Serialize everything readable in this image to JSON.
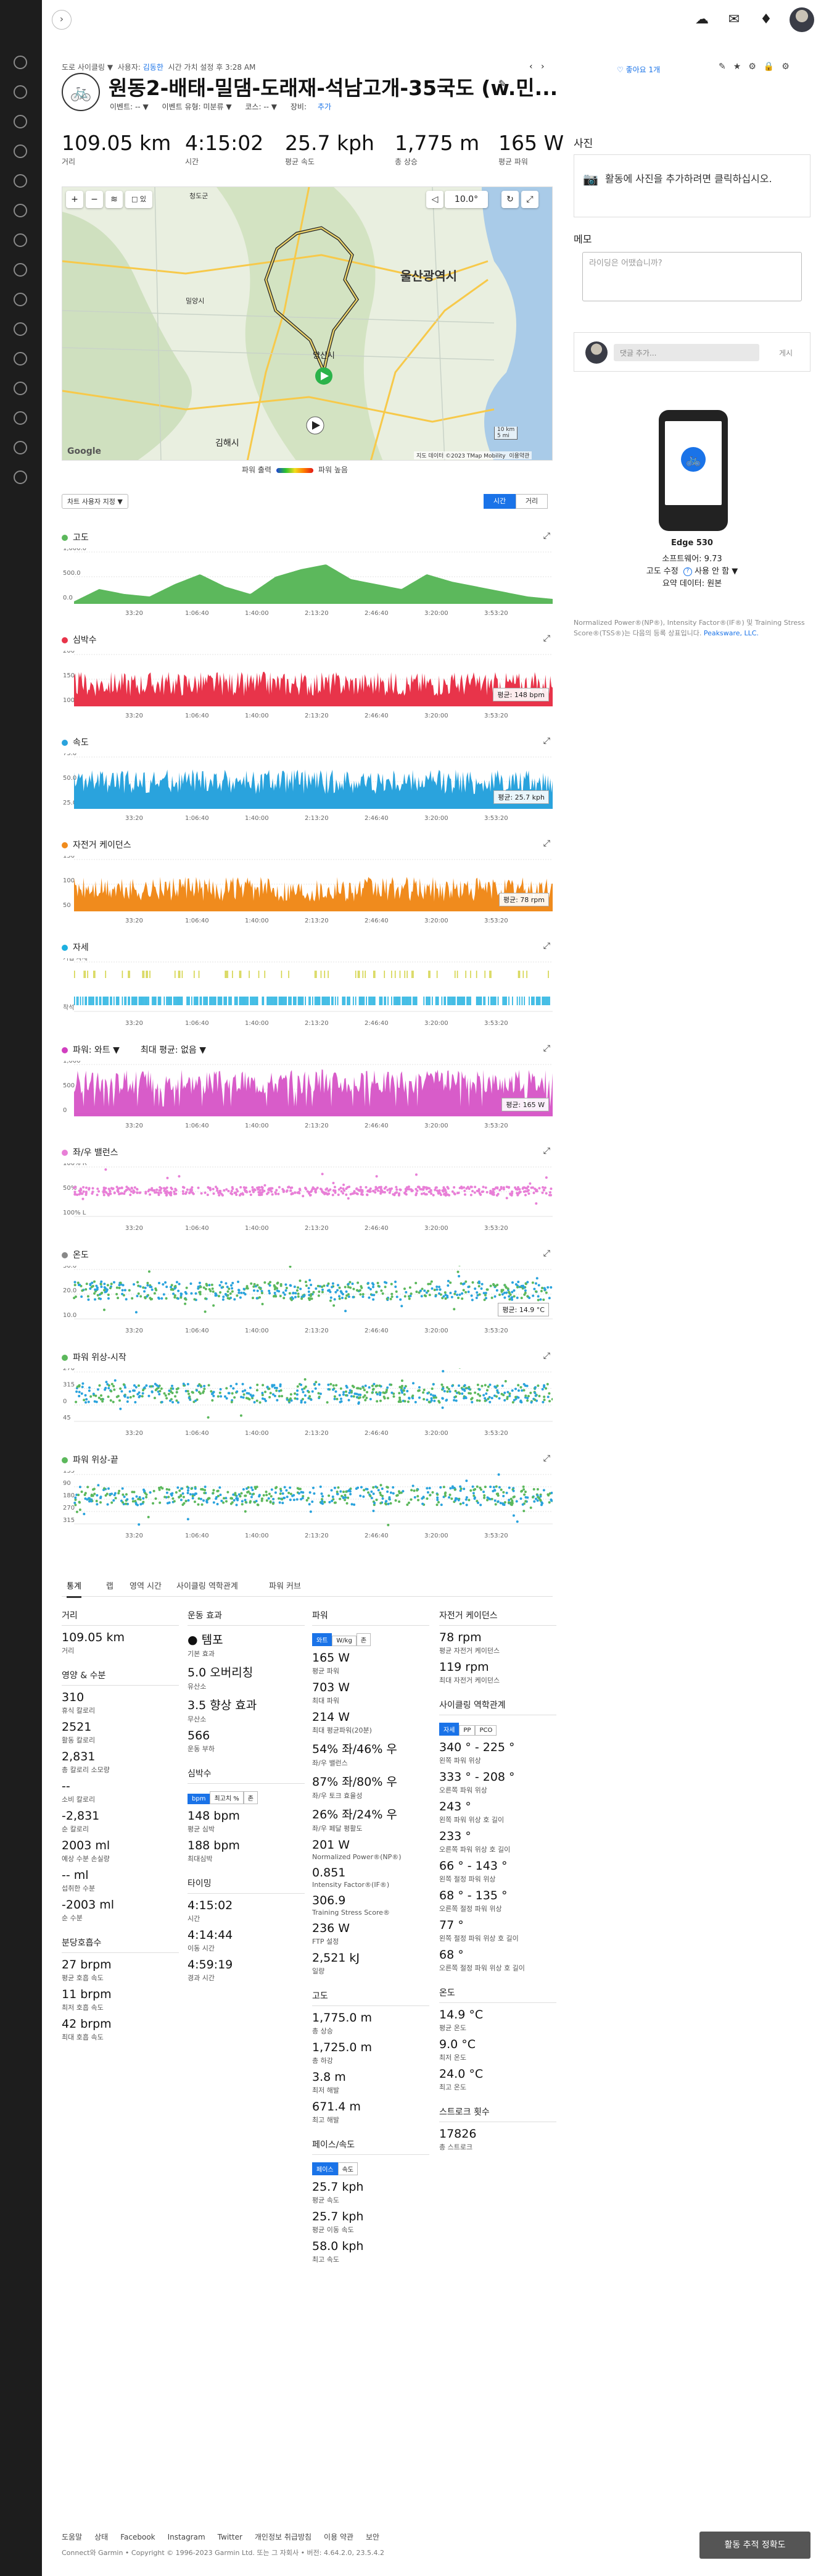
{
  "breadcrumb": {
    "pre": "도로 사이클링 ▼",
    "by": "사용자:",
    "user": "김동한",
    "time": "시간 가치 설정 후 3:28 AM"
  },
  "title": "원동2-배태-밀댐-도래재-석남고개-35국도 (w.민...",
  "sub": {
    "event": "이벤트: -- ▼",
    "event_type": "이벤트 유형: 미분류 ▼",
    "course": "코스: -- ▼",
    "gear_label": "장비:",
    "gear_link": "추가"
  },
  "likes": "좋아요 1개",
  "top_stats": [
    {
      "v": "109.05 km",
      "l": "거리"
    },
    {
      "v": "4:15:02",
      "l": "시간"
    },
    {
      "v": "25.7 kph",
      "l": "평균 속도"
    },
    {
      "v": "1,775 m",
      "l": "총 상승"
    },
    {
      "v": "165 W",
      "l": "평균 파워"
    }
  ],
  "map": {
    "temp": "10.0°",
    "scale_km": "10 km",
    "scale_mi": "5 mi",
    "attribution": "지도 데이터 ©2023 TMap Mobility",
    "terms": "이용약관",
    "google": "Google",
    "city1": "울산광역시",
    "city2": "양산시",
    "city3": "김해시",
    "city4": "밀양시",
    "city5": "청도군",
    "layer_box": "□ 있"
  },
  "power_legend": {
    "low": "파워 출력",
    "high": "파워 높음"
  },
  "chart_select": "차트 사용자 지정 ▼",
  "toggle": {
    "time": "시간",
    "dist": "거리"
  },
  "charts": [
    {
      "title": "고도",
      "color": "#5cb85c",
      "avg": "",
      "ylabels": [
        "1,000.0",
        "500.0",
        "0.0"
      ]
    },
    {
      "title": "심박수",
      "color": "#e8344a",
      "avg": "평균: 148 bpm",
      "ylabels": [
        "200",
        "150",
        "100"
      ]
    },
    {
      "title": "속도",
      "color": "#2aa3dd",
      "avg": "평균: 25.7 kph",
      "ylabels": [
        "75.0",
        "50.0",
        "25.0"
      ]
    },
    {
      "title": "자전거 케이던스",
      "color": "#f08b1d",
      "avg": "평균: 78 rpm",
      "ylabels": [
        "150",
        "100",
        "50"
      ]
    },
    {
      "title": "자세",
      "color": "#1eb0e0",
      "avg": "",
      "ylabels": [
        "기립 자세",
        "착석"
      ]
    },
    {
      "title": "파워: 와트 ▼",
      "title2": "최대 평균: 없음 ▼",
      "color": "#d13fc0",
      "avg": "평균: 165 W",
      "ylabels": [
        "1,000",
        "500",
        "0"
      ]
    },
    {
      "title": "좌/우 밸런스",
      "color": "#e87fd7",
      "avg": "",
      "ylabels": [
        "100% R",
        "50%",
        "100% L"
      ]
    },
    {
      "title": "온도",
      "color": "#888888",
      "avg": "평균: 14.9 °C",
      "ylabels": [
        "30.0",
        "20.0",
        "10.0"
      ]
    },
    {
      "title": "파워 위상-시작",
      "color": "#5cb85c",
      "avg": "",
      "ylabels": [
        "270",
        "315",
        "0",
        "45"
      ]
    },
    {
      "title": "파워 위상-끝",
      "color": "#5cb85c",
      "avg": "",
      "ylabels": [
        "135",
        "90",
        "180",
        "270",
        "315"
      ]
    }
  ],
  "xticks": [
    "33:20",
    "1:06:40",
    "1:40:00",
    "2:13:20",
    "2:46:40",
    "3:20:00",
    "3:53:20"
  ],
  "right": {
    "photos_h": "사진",
    "photos_text": "활동에 사진을 추가하려면 클릭하십시오.",
    "memo_h": "메모",
    "memo_ph": "라이딩은 어땠습니까?",
    "comment_ph": "댓글 추가...",
    "comment_btn": "게시",
    "device": "Edge 530",
    "fw": "소프트웨어: 9.73",
    "elev_corr": "고도 수정",
    "elev_corr_val": "사용 안 함 ▼",
    "summary": "요약 데이터: 원본",
    "note": "Normalized Power®(NP®), Intensity Factor®(IF®) 및 Training Stress Score®(TSS®)는 다음의 등록 상표입니다.",
    "note_link": "Peaksware, LLC."
  },
  "tabs": [
    "통계",
    "랩",
    "영역 시간",
    "사이클링 역학관계",
    "파워 커브"
  ],
  "stats_col1": [
    {
      "h": "거리"
    },
    {
      "v": "109.05 km",
      "l": "거리"
    },
    {
      "h": "영양 & 수분"
    },
    {
      "v": "310",
      "l": "휴식 칼로리"
    },
    {
      "v": "2521",
      "l": "활동 칼로리"
    },
    {
      "v": "2,831",
      "l": "총 칼로리 소모량"
    },
    {
      "v": "--",
      "l": "소비 칼로리"
    },
    {
      "v": "-2,831",
      "l": "순 칼로리"
    },
    {
      "v": "2003 ml",
      "l": "예상 수분 손실량"
    },
    {
      "v": "-- ml",
      "l": "섭취한 수분"
    },
    {
      "v": "-2003 ml",
      "l": "순 수분"
    },
    {
      "h": "분당호흡수"
    },
    {
      "v": "27 brpm",
      "l": "평균 호흡 속도"
    },
    {
      "v": "11 brpm",
      "l": "최저 호흡 속도"
    },
    {
      "v": "42 brpm",
      "l": "최대 호흡 속도"
    }
  ],
  "stats_col2": [
    {
      "h": "운동 효과"
    },
    {
      "v": "● 템포",
      "l": "기본 효과"
    },
    {
      "v": "5.0 오버리칭",
      "l": "유산소"
    },
    {
      "v": "3.5 향상 효과",
      "l": "무산소"
    },
    {
      "v": "566",
      "l": "운동 부하"
    },
    {
      "h": "심박수"
    },
    {
      "seg": [
        "bpm",
        "최고치 %",
        "존"
      ]
    },
    {
      "v": "148 bpm",
      "l": "평균 심박"
    },
    {
      "v": "188 bpm",
      "l": "최대심박"
    },
    {
      "h": "타이밍"
    },
    {
      "v": "4:15:02",
      "l": "시간"
    },
    {
      "v": "4:14:44",
      "l": "이동 시간"
    },
    {
      "v": "4:59:19",
      "l": "경과 시간"
    }
  ],
  "stats_col3": [
    {
      "h": "파워"
    },
    {
      "seg": [
        "와트",
        "W/kg",
        "존"
      ]
    },
    {
      "v": "165 W",
      "l": "평균 파워"
    },
    {
      "v": "703 W",
      "l": "최대 파워"
    },
    {
      "v": "214 W",
      "l": "최대 평균파워(20분)"
    },
    {
      "v": "54% 좌/46% 우",
      "l": "좌/우 밸런스"
    },
    {
      "v": "87% 좌/80% 우",
      "l": "좌/우 토크 효율성"
    },
    {
      "v": "26% 좌/24% 우",
      "l": "좌/우 페달 평활도"
    },
    {
      "v": "201 W",
      "l": "Normalized Power®(NP®)"
    },
    {
      "v": "0.851",
      "l": "Intensity Factor®(IF®)"
    },
    {
      "v": "306.9",
      "l": "Training Stress Score®"
    },
    {
      "v": "236 W",
      "l": "FTP 설정"
    },
    {
      "v": "2,521 kJ",
      "l": "일량"
    },
    {
      "h": "고도"
    },
    {
      "v": "1,775.0 m",
      "l": "총 상승"
    },
    {
      "v": "1,725.0 m",
      "l": "총 하강"
    },
    {
      "v": "3.8 m",
      "l": "최저 해발"
    },
    {
      "v": "671.4 m",
      "l": "최고 해발"
    },
    {
      "h": "페이스/속도"
    },
    {
      "seg": [
        "페이스",
        "속도"
      ]
    },
    {
      "v": "25.7 kph",
      "l": "평균 속도"
    },
    {
      "v": "25.7 kph",
      "l": "평균 이동 속도"
    },
    {
      "v": "58.0 kph",
      "l": "최고 속도"
    }
  ],
  "stats_col4": [
    {
      "h": "자전거 케이던스"
    },
    {
      "v": "78 rpm",
      "l": "평균 자전거 케이던스"
    },
    {
      "v": "119 rpm",
      "l": "최대 자전거 케이던스"
    },
    {
      "h": "사이클링 역학관계"
    },
    {
      "seg": [
        "자세",
        "PP",
        "PCO"
      ]
    },
    {
      "v": "340 ° - 225 °",
      "l": "왼쪽 파워 위상"
    },
    {
      "v": "333 ° - 208 °",
      "l": "오른쪽 파워 위상"
    },
    {
      "v": "243 °",
      "l": "왼쪽 파워 위상 호 길이"
    },
    {
      "v": "233 °",
      "l": "오른쪽 파워 위상 호 길이"
    },
    {
      "v": "66 ° - 143 °",
      "l": "왼쪽 절정 파워 위상"
    },
    {
      "v": "68 ° - 135 °",
      "l": "오른쪽 절정 파워 위상"
    },
    {
      "v": "77 °",
      "l": "왼쪽 절정 파워 위상 호 길이"
    },
    {
      "v": "68 °",
      "l": "오른쪽 절정 파워 위상 호 길이"
    },
    {
      "h": "온도"
    },
    {
      "v": "14.9 °C",
      "l": "평균 온도"
    },
    {
      "v": "9.0 °C",
      "l": "최저 온도"
    },
    {
      "v": "24.0 °C",
      "l": "최고 온도"
    },
    {
      "h": "스트로크 횟수"
    },
    {
      "v": "17826",
      "l": "총 스트로크"
    }
  ],
  "footer": [
    "도움말",
    "상태",
    "Facebook",
    "Instagram",
    "Twitter",
    "개인정보 취급방침",
    "이용 약관",
    "보안"
  ],
  "copyright": "Connect와 Garmin • Copyright © 1996-2023 Garmin Ltd. 또는 그 자회사 • 버전: 4.64.2.0, 23.5.4.2",
  "accuracy_btn": "활동 추적 정확도"
}
